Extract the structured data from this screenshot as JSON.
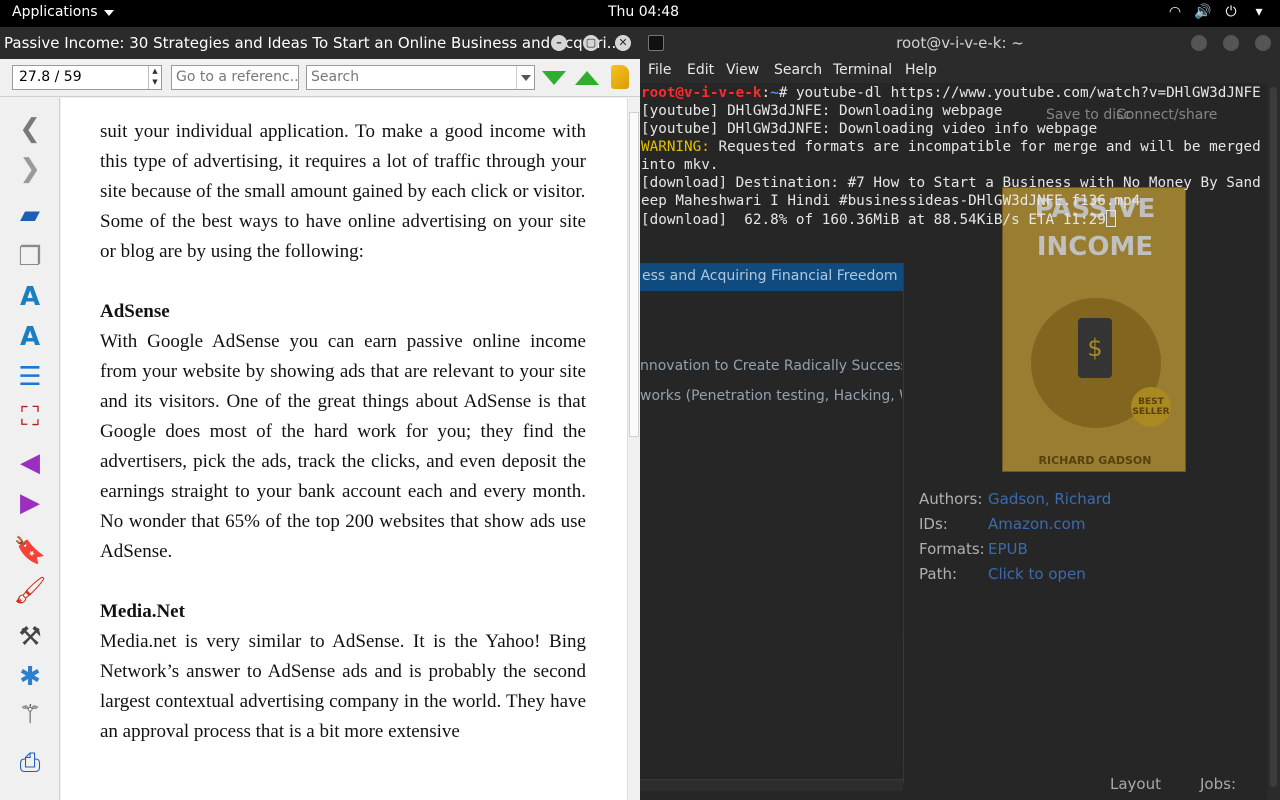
{
  "topbar": {
    "applications_label": "Applications",
    "clock": "Thu 04:48"
  },
  "viewer": {
    "window_title": "Passive Income: 30 Strategies and Ideas To Start an Online Business and Acquiri...",
    "position_value": "27.8 / 59",
    "goto_placeholder": "Go to a referenc...",
    "search_placeholder": "Search",
    "content": {
      "para1": "suit your individual application. To make a good income with this type of advertising, it requires a lot of traffic through your site because of the small amount gained by each click or visitor.",
      "para2": "Some of the best ways to have online advertising on your site or blog are by using the following:",
      "heading1": "AdSense",
      "para3": "With Google AdSense you can earn passive online income from your website by showing ads that are relevant to your site and its visitors. One of the great things about AdSense is that Google does most of the hard work for you; they find the advertisers, pick the ads, track the clicks, and even deposit the earnings straight to your bank account each and every month. No wonder that 65% of the top 200 websites that show ads use AdSense.",
      "heading2": "Media.Net",
      "para4": "Media.net is very similar to AdSense. It is the Yahoo! Bing Network’s answer to AdSense ads and is probably the second largest contextual advertising company in the world. They have an approval process that is a bit more extensive"
    }
  },
  "terminal": {
    "window_title": "root@v-i-v-e-k: ~",
    "menu": [
      "File",
      "Edit",
      "View",
      "Search",
      "Terminal",
      "Help"
    ],
    "prompt_user": "root@v-i-v-e-k",
    "prompt_sep": ":",
    "prompt_path": "~",
    "prompt_hash": "# ",
    "command": "youtube-dl https://www.youtube.com/watch?v=DHlGW3dJNFE",
    "line1": "[youtube] DHlGW3dJNFE: Downloading webpage",
    "line2": "[youtube] DHlGW3dJNFE: Downloading video info webpage",
    "warn_label": "WARNING:",
    "warn_text": " Requested formats are incompatible for merge and will be merged into mkv.",
    "line4": "[download] Destination: #7 How to Start a Business with No Money By Sandeep Maheshwari I Hindi #businessideas-DHlGW3dJNFE.f136.mp4",
    "line5": "[download]  62.8% of 160.36MiB at 88.54KiB/s ETA 11:29"
  },
  "library_bg": {
    "toolbar_items": [
      "Save to disc",
      "Connect/share"
    ],
    "banner": "ess and Acquiring Financial Freedom (Pa",
    "list": [
      "nnovation to Create Radically Successful",
      "works (Penetration testing, Hacking, Wire"
    ],
    "cover_title": "PASSIVE INCOME",
    "cover_author": "RICHARD GADSON",
    "cover_badge": "BEST SELLER",
    "authors_key": "Authors:",
    "authors_val": "Gadson, Richard",
    "ids_key": "IDs:",
    "ids_val": "Amazon.com",
    "formats_key": "Formats:",
    "formats_val": "EPUB",
    "path_key": "Path:",
    "path_val": "Click to open",
    "layout_label": "Layout",
    "jobs_label": "Jobs:"
  }
}
